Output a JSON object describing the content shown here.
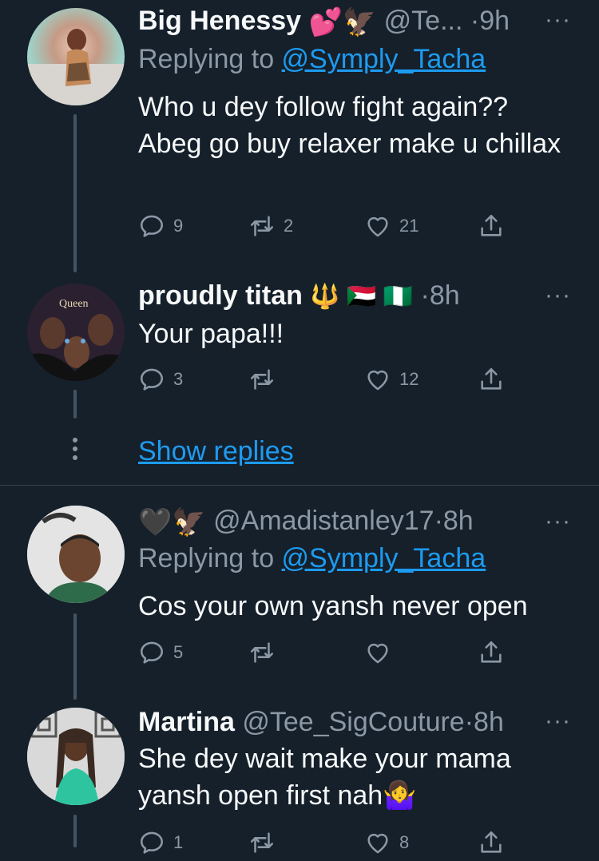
{
  "tweets": [
    {
      "name": "Big Henessy",
      "name_emoji": "💕🦅",
      "handle": "@Te...",
      "time": "9h",
      "replying_prefix": "Replying to ",
      "replying_to": "@Symply_Tacha",
      "text": "Who u dey follow fight again?? Abeg go buy relaxer make u chillax",
      "replies": "9",
      "retweets": "2",
      "likes": "21"
    },
    {
      "name": "proudly titan",
      "name_emoji": "🔱 🇸🇩 🇳🇬",
      "time": "8h",
      "avatar_label": "Queen",
      "text": "Your papa!!!",
      "replies": "3",
      "retweets": "",
      "likes": "12"
    },
    {
      "name_emoji": "🖤🦅",
      "handle": "@Amadistanley17",
      "time": "8h",
      "replying_prefix": "Replying to ",
      "replying_to": "@Symply_Tacha",
      "text": "Cos your own yansh never open",
      "replies": "5",
      "retweets": "",
      "likes": ""
    },
    {
      "name": "Martina",
      "handle": "@Tee_SigCouture",
      "time": "8h",
      "text": "She dey wait make your mama yansh  open first nah🤷‍♀️",
      "replies": "1",
      "retweets": "",
      "likes": "8"
    }
  ],
  "show_replies": "Show replies",
  "more_glyph": "···",
  "dot": "·",
  "icons": [
    "reply-icon",
    "retweet-icon",
    "like-icon",
    "share-icon",
    "more-icon"
  ],
  "colors": {
    "background": "#15202b",
    "link": "#1d9bf0",
    "muted": "#8b98a5",
    "text": "#f7f9f9"
  }
}
